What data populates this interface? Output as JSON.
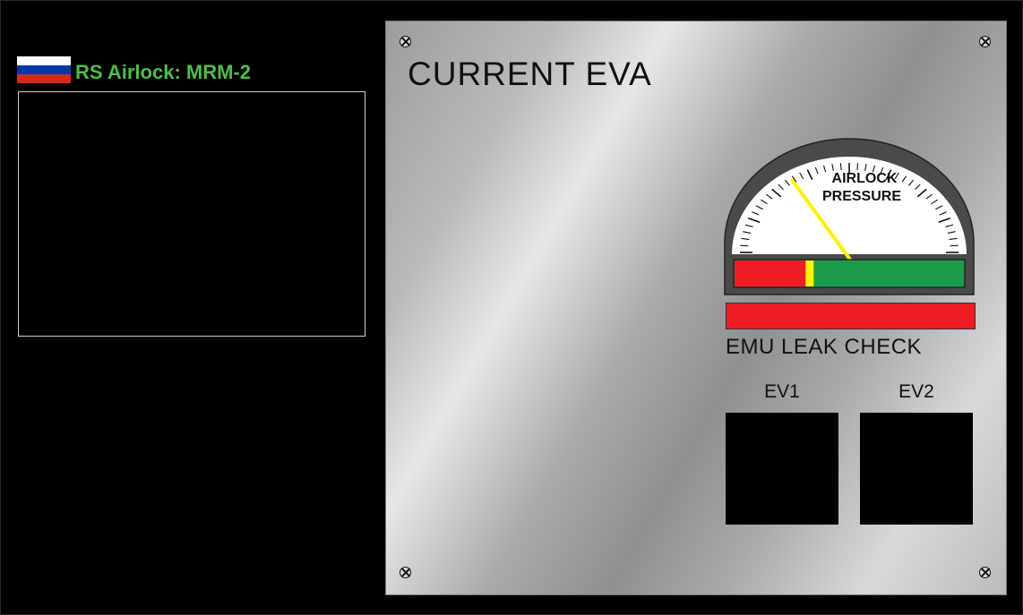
{
  "airlock": {
    "name": "RS Airlock: MRM-2",
    "flag_colors": [
      "#ffffff",
      "#0039a6",
      "#d52b1e"
    ]
  },
  "panel": {
    "title": "CURRENT EVA",
    "gauge": {
      "label_line1": "AIRLOCK",
      "label_line2": "PRESSURE",
      "needle_fraction": 0.3,
      "band_red_fraction": 0.31,
      "band_yellow_fraction": 0.035,
      "band_colors": {
        "red": "#ee1c25",
        "yellow": "#fff200",
        "green": "#1a9b4b"
      }
    },
    "leak_check": {
      "label": "EMU LEAK CHECK",
      "status_color": "#ee1c25"
    },
    "crew": [
      {
        "label": "EV1"
      },
      {
        "label": "EV2"
      }
    ]
  }
}
